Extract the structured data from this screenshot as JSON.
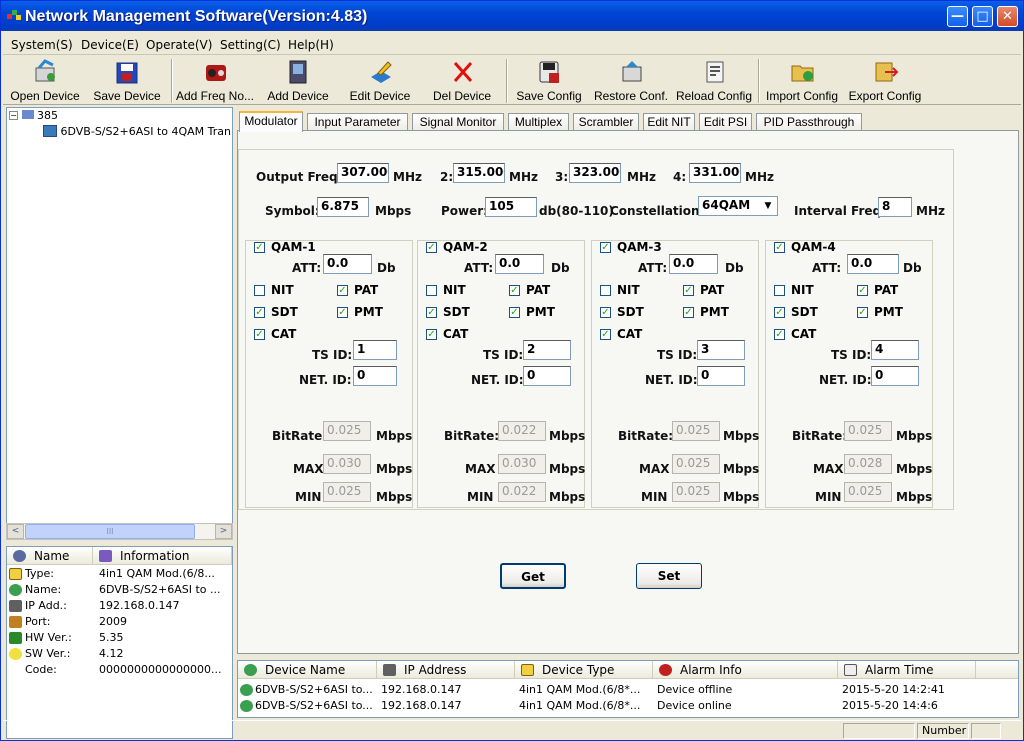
{
  "window": {
    "title": "Network Management Software(Version:4.83)",
    "min_glyph": "—",
    "max_glyph": "□",
    "close_glyph": "✕"
  },
  "menu": [
    "System(S)",
    "Device(E)",
    "Operate(V)",
    "Setting(C)",
    "Help(H)"
  ],
  "toolbar": [
    {
      "label": "Open Device",
      "icon": "open-device-icon"
    },
    {
      "label": "Save Device",
      "icon": "save-device-icon"
    },
    {
      "label": "Add Freq No...",
      "icon": "add-freq-icon"
    },
    {
      "label": "Add Device",
      "icon": "add-device-icon"
    },
    {
      "label": "Edit Device",
      "icon": "edit-device-icon"
    },
    {
      "label": "Del Device",
      "icon": "delete-icon"
    },
    {
      "label": "Save Config",
      "icon": "save-config-icon"
    },
    {
      "label": "Restore Conf.",
      "icon": "restore-config-icon"
    },
    {
      "label": "Reload Config",
      "icon": "reload-config-icon"
    },
    {
      "label": "Import Config",
      "icon": "import-config-icon"
    },
    {
      "label": "Export Config",
      "icon": "export-config-icon"
    }
  ],
  "tree": {
    "root": "385",
    "child": "6DVB-S/S2+6ASI to 4QAM Tran"
  },
  "scroll": {
    "left": "<",
    "right": ">",
    "grip": "III"
  },
  "info": {
    "headers": [
      "Name",
      "Information"
    ],
    "rows": [
      {
        "name": "Type:",
        "value": "4in1 QAM Mod.(6/8..."
      },
      {
        "name": "Name:",
        "value": "6DVB-S/S2+6ASI to ..."
      },
      {
        "name": "IP Add.:",
        "value": "192.168.0.147"
      },
      {
        "name": "Port:",
        "value": "2009"
      },
      {
        "name": "HW Ver.:",
        "value": "5.35"
      },
      {
        "name": "SW Ver.:",
        "value": "4.12"
      },
      {
        "name": "Code:",
        "value": "0000000000000000..."
      }
    ]
  },
  "tabs": [
    "Modulator",
    "Input Parameter",
    "Signal Monitor",
    "Multiplex",
    "Scrambler",
    "Edit NIT",
    "Edit PSI",
    "PID Passthrough"
  ],
  "modulator": {
    "freq_label": "Output Freq.:",
    "freqs": [
      {
        "num": "",
        "value": "307.000"
      },
      {
        "num": "2:",
        "value": "315.000"
      },
      {
        "num": "3:",
        "value": "323.000"
      },
      {
        "num": "4:",
        "value": "331.000"
      }
    ],
    "mhz": "MHz",
    "symbol_label": "Symbol:",
    "symbol": "6.875",
    "symbol_unit": "Mbps",
    "power_label": "Power:",
    "power": "105",
    "power_unit": "db(80-110)",
    "constellation_label": "Constellation:",
    "constellation": "64QAM",
    "interval_label": "Interval Freq.:",
    "interval": "8",
    "interval_unit": "MHz",
    "labels": {
      "att": "ATT:",
      "db": "Db",
      "nit": "NIT",
      "pat": "PAT",
      "sdt": "SDT",
      "pmt": "PMT",
      "cat": "CAT",
      "tsid": "TS ID:",
      "netid": "NET. ID:",
      "bitrate": "BitRate:",
      "max": "MAX",
      "min": "MIN",
      "mbps": "Mbps"
    },
    "channels": [
      {
        "name": "QAM-1",
        "enabled": true,
        "att": "0.0",
        "nit": false,
        "pat": true,
        "sdt": true,
        "pmt": true,
        "cat": true,
        "ts_id": "1",
        "net_id": "0",
        "bitrate": "0.025",
        "max": "0.030",
        "min": "0.025"
      },
      {
        "name": "QAM-2",
        "enabled": true,
        "att": "0.0",
        "nit": false,
        "pat": true,
        "sdt": true,
        "pmt": true,
        "cat": true,
        "ts_id": "2",
        "net_id": "0",
        "bitrate": "0.022",
        "max": "0.030",
        "min": "0.022"
      },
      {
        "name": "QAM-3",
        "enabled": true,
        "att": "0.0",
        "nit": false,
        "pat": true,
        "sdt": true,
        "pmt": true,
        "cat": true,
        "ts_id": "3",
        "net_id": "0",
        "bitrate": "0.025",
        "max": "0.025",
        "min": "0.025"
      },
      {
        "name": "QAM-4",
        "enabled": true,
        "att": "0.0",
        "nit": false,
        "pat": true,
        "sdt": true,
        "pmt": true,
        "cat": true,
        "ts_id": "4",
        "net_id": "0",
        "bitrate": "0.025",
        "max": "0.028",
        "min": "0.025"
      }
    ],
    "get_label": "Get",
    "set_label": "Set"
  },
  "alarm": {
    "headers": [
      "Device Name",
      "IP Address",
      "Device Type",
      "Alarm Info",
      "Alarm Time"
    ],
    "rows": [
      {
        "name": "6DVB-S/S2+6ASI to...",
        "ip": "192.168.0.147",
        "type": "4in1 QAM Mod.(6/8*...",
        "info": "Device offline",
        "time": "2015-5-20 14:2:41"
      },
      {
        "name": "6DVB-S/S2+6ASI to...",
        "ip": "192.168.0.147",
        "type": "4in1 QAM Mod.(6/8*...",
        "info": "Device online",
        "time": "2015-5-20 14:4:6"
      }
    ]
  },
  "status": {
    "number": "Number"
  },
  "colors": {
    "title_bar": "#0046d5",
    "tab_highlight": "#f7b533",
    "check": "#21a121",
    "delete_red": "#e01010"
  }
}
